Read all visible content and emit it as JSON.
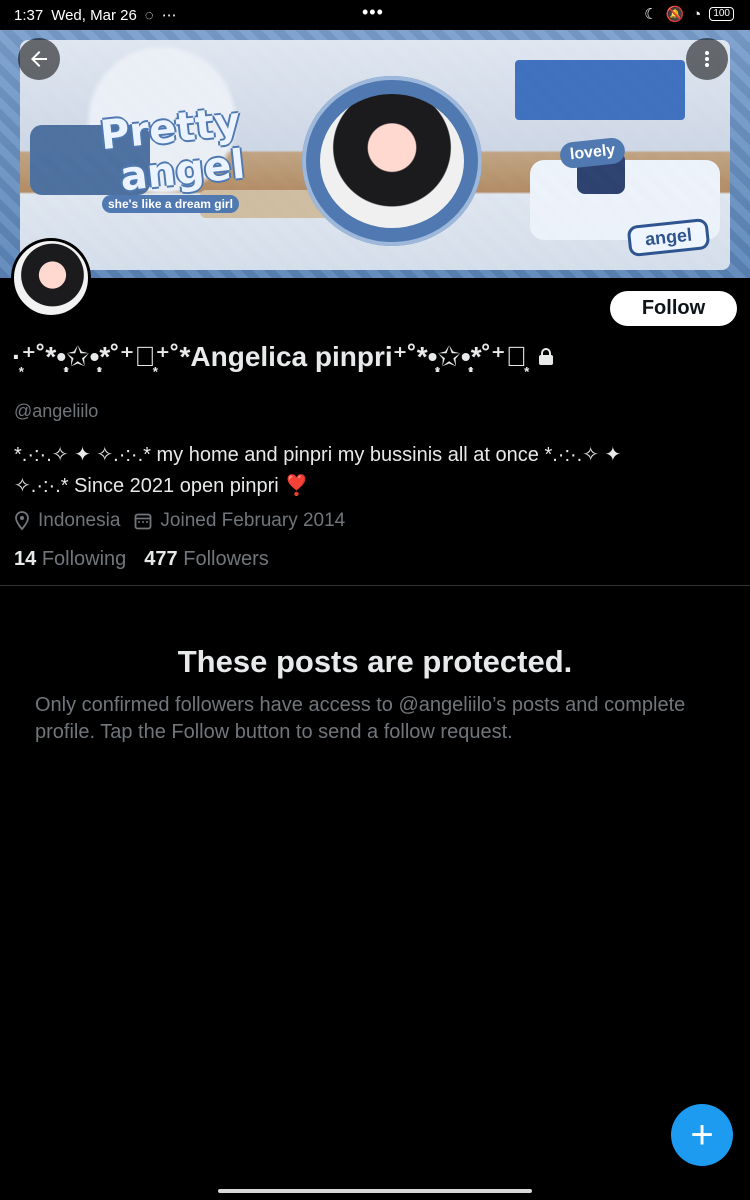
{
  "status_bar": {
    "time": "1:37",
    "date": "Wed, Mar 26",
    "center": "•••",
    "battery": "100"
  },
  "banner": {
    "title_line1": "Pretty",
    "title_line2": "angel",
    "subtitle": "she's like a dream girl",
    "tag_lovely": "lovely",
    "tag_angel": "angel"
  },
  "profile": {
    "display_name": "·͙⁺˚*•̩̩͙✩•̩̩͙*˚⁺‧͙⁺˚*Angelica pinpri⁺˚*•̩̩͙✩•̩̩͙*˚⁺‧͙",
    "username": "@angeliilo",
    "bio_line1": "*.·:·.✧    ✦    ✧.·:·.*     my home and pinpri my        bussinis all at once *.·:·.✧    ✦",
    "bio_line2": "✧.·:·.* Since 2021 open pinpri  ❣️",
    "location": "Indonesia",
    "joined": "Joined February 2014",
    "following_count": "14",
    "following_label": "Following",
    "followers_count": "477",
    "followers_label": "Followers",
    "follow_button": "Follow"
  },
  "protected": {
    "title": "These posts are protected.",
    "text": "Only confirmed followers have access to @angeliilo’s posts and complete profile. Tap the Follow button to send a follow request."
  },
  "fab": {
    "label": "+"
  },
  "colors": {
    "background": "#000000",
    "accent": "#1d9bf0",
    "muted": "#71767b",
    "primary_text": "#e7e9ea"
  },
  "icons": {
    "back": "arrow-left-icon",
    "more": "more-vertical-icon",
    "lock": "lock-icon",
    "location": "location-icon",
    "calendar": "calendar-icon",
    "compose": "plus-icon"
  }
}
